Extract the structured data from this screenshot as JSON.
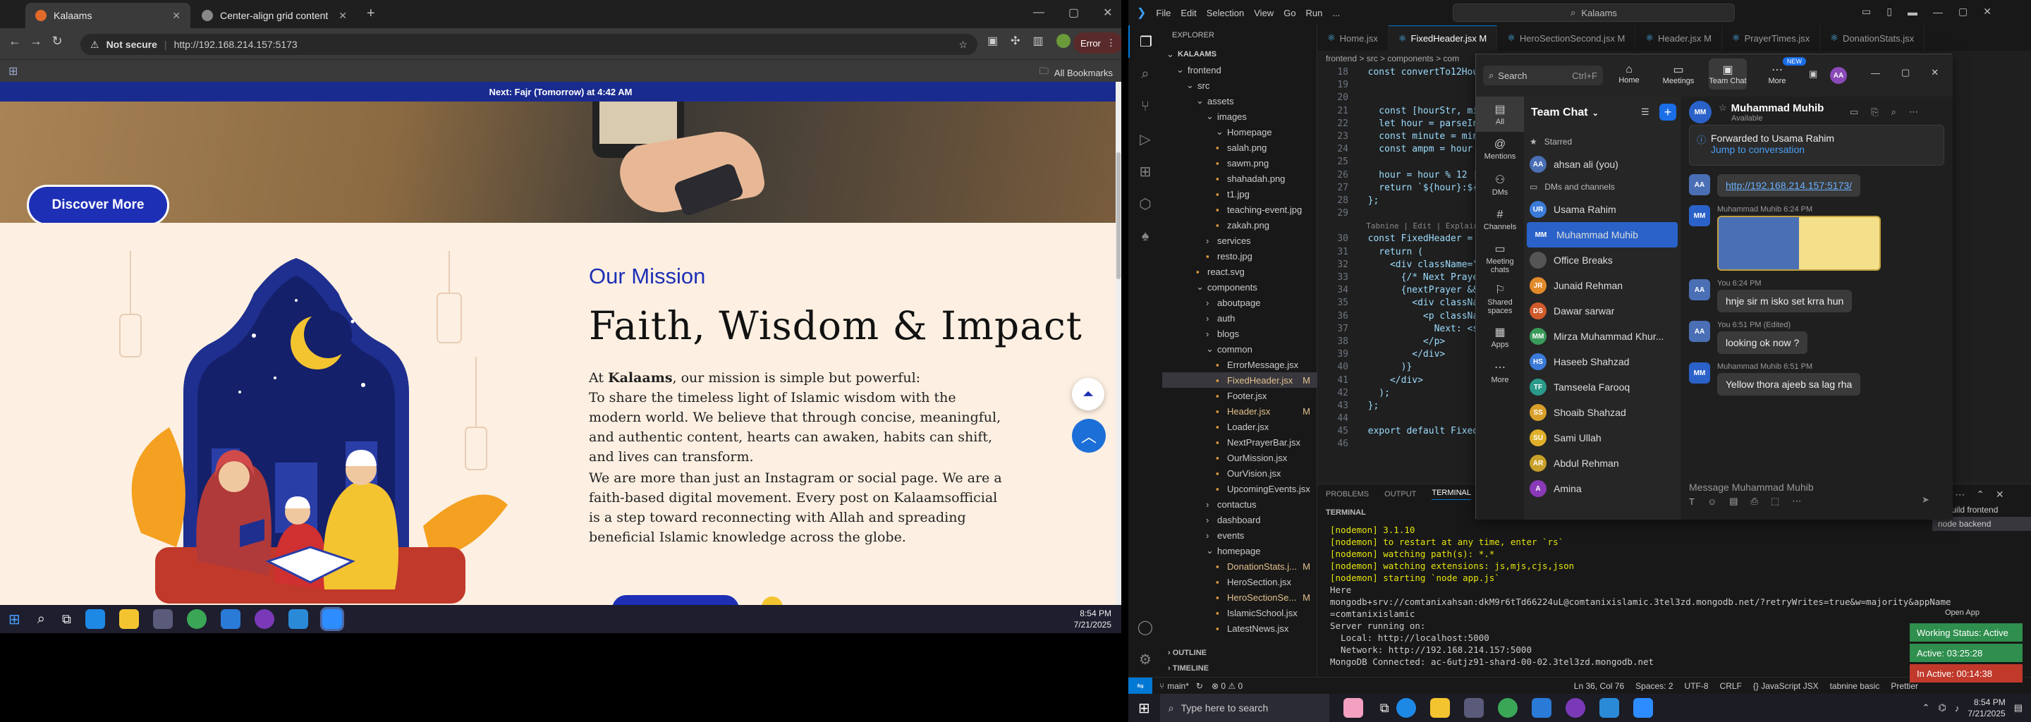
{
  "browser": {
    "tabs": [
      {
        "title": "Kalaams",
        "active": true
      },
      {
        "title": "Center-align grid content",
        "active": false
      }
    ],
    "url_warning": "Not secure",
    "url": "http://192.168.214.157:5173",
    "error_label": "Error",
    "bookmarks_label": "All Bookmarks"
  },
  "site": {
    "next_prayer": "Next: Fajr (Tomorrow) at 4:42 AM",
    "discover_button": "Discover More",
    "mission_label": "Our Mission",
    "mission_title": "Faith, Wisdom & Impact",
    "para1_prefix": "At ",
    "para1_brand": "Kalaams",
    "para1_rest": ", our mission is simple but powerful:",
    "para2": "To share the timeless light of Islamic wisdom with the modern world. We believe that through concise, meaningful, and authentic content, hearts can awaken, habits can shift, and lives can transform.",
    "para3": "We are more than just an Instagram or social page. We are a faith-based digital movement. Every post on Kalaamsofficial is a step toward reconnecting with Allah and spreading beneficial Islamic knowledge across the globe."
  },
  "left_taskbar": {
    "time": "8:54 PM",
    "date": "7/21/2025"
  },
  "vscode": {
    "menu": [
      "File",
      "Edit",
      "Selection",
      "View",
      "Go",
      "Run",
      "..."
    ],
    "search": "Kalaams",
    "explorer_title": "EXPLORER",
    "tree": [
      {
        "label": "KALAAMS",
        "depth": 0,
        "type": "root"
      },
      {
        "label": "frontend",
        "depth": 1,
        "type": "folder"
      },
      {
        "label": "src",
        "depth": 2,
        "type": "folder"
      },
      {
        "label": "assets",
        "depth": 3,
        "type": "folder"
      },
      {
        "label": "images",
        "depth": 4,
        "type": "folder"
      },
      {
        "label": "Homepage",
        "depth": 5,
        "type": "folder"
      },
      {
        "label": "salah.png",
        "depth": 5,
        "type": "file"
      },
      {
        "label": "sawm.png",
        "depth": 5,
        "type": "file"
      },
      {
        "label": "shahadah.png",
        "depth": 5,
        "type": "file"
      },
      {
        "label": "t1.jpg",
        "depth": 5,
        "type": "file"
      },
      {
        "label": "teaching-event.jpg",
        "depth": 5,
        "type": "file"
      },
      {
        "label": "zakah.png",
        "depth": 5,
        "type": "file"
      },
      {
        "label": "services",
        "depth": 4,
        "type": "folder"
      },
      {
        "label": "resto.jpg",
        "depth": 4,
        "type": "file"
      },
      {
        "label": "react.svg",
        "depth": 3,
        "type": "file"
      },
      {
        "label": "components",
        "depth": 3,
        "type": "folder"
      },
      {
        "label": "aboutpage",
        "depth": 4,
        "type": "folder"
      },
      {
        "label": "auth",
        "depth": 4,
        "type": "folder"
      },
      {
        "label": "blogs",
        "depth": 4,
        "type": "folder"
      },
      {
        "label": "common",
        "depth": 4,
        "type": "folder"
      },
      {
        "label": "ErrorMessage.jsx",
        "depth": 5,
        "type": "file"
      },
      {
        "label": "FixedHeader.jsx",
        "depth": 5,
        "type": "file",
        "badge": "M",
        "selected": true
      },
      {
        "label": "Footer.jsx",
        "depth": 5,
        "type": "file"
      },
      {
        "label": "Header.jsx",
        "depth": 5,
        "type": "file",
        "badge": "M"
      },
      {
        "label": "Loader.jsx",
        "depth": 5,
        "type": "file"
      },
      {
        "label": "NextPrayerBar.jsx",
        "depth": 5,
        "type": "file"
      },
      {
        "label": "OurMission.jsx",
        "depth": 5,
        "type": "file"
      },
      {
        "label": "OurVision.jsx",
        "depth": 5,
        "type": "file"
      },
      {
        "label": "UpcomingEvents.jsx",
        "depth": 5,
        "type": "file"
      },
      {
        "label": "contactus",
        "depth": 4,
        "type": "folder"
      },
      {
        "label": "dashboard",
        "depth": 4,
        "type": "folder"
      },
      {
        "label": "events",
        "depth": 4,
        "type": "folder"
      },
      {
        "label": "homepage",
        "depth": 4,
        "type": "folder"
      },
      {
        "label": "DonationStats.j...",
        "depth": 5,
        "type": "file",
        "badge": "M"
      },
      {
        "label": "HeroSection.jsx",
        "depth": 5,
        "type": "file"
      },
      {
        "label": "HeroSectionSe...",
        "depth": 5,
        "type": "file",
        "badge": "M"
      },
      {
        "label": "IslamicSchool.jsx",
        "depth": 5,
        "type": "file"
      },
      {
        "label": "LatestNews.jsx",
        "depth": 5,
        "type": "file"
      }
    ],
    "outline": "OUTLINE",
    "timeline": "TIMELINE",
    "editor_tabs": [
      {
        "label": "Home.jsx",
        "active": false
      },
      {
        "label": "FixedHeader.jsx M",
        "active": true
      },
      {
        "label": "HeroSectionSecond.jsx M",
        "active": false
      },
      {
        "label": "Header.jsx M",
        "active": false
      },
      {
        "label": "PrayerTimes.jsx",
        "active": false
      },
      {
        "label": "DonationStats.jsx",
        "active": false
      }
    ],
    "breadcrumb": "frontend > src > components > com",
    "code_lines": [
      {
        "n": "18",
        "t": "  const convertTo12Hou"
      },
      {
        "n": "19",
        "t": ""
      },
      {
        "n": "20",
        "t": ""
      },
      {
        "n": "21",
        "t": "    const [hourStr, min"
      },
      {
        "n": "22",
        "t": "    let hour = parseInt"
      },
      {
        "n": "23",
        "t": "    const minute = minu"
      },
      {
        "n": "24",
        "t": "    const ampm = hour >"
      },
      {
        "n": "25",
        "t": ""
      },
      {
        "n": "26",
        "t": "    hour = hour % 12 ||"
      },
      {
        "n": "27",
        "t": "    return `${hour}:${m"
      },
      {
        "n": "28",
        "t": "  };"
      },
      {
        "n": "29",
        "t": ""
      },
      {
        "n": "",
        "t": "  Tabnine | Edit | Explain"
      },
      {
        "n": "30",
        "t": "  const FixedHeader = ("
      },
      {
        "n": "31",
        "t": "    return ("
      },
      {
        "n": "32",
        "t": "      <div className=\""
      },
      {
        "n": "33",
        "t": "        {/* Next Prayer"
      },
      {
        "n": "34",
        "t": "        {nextPrayer &&"
      },
      {
        "n": "35",
        "t": "          <div classNam"
      },
      {
        "n": "36",
        "t": "            <p classNam"
      },
      {
        "n": "37",
        "t": "              Next: <st"
      },
      {
        "n": "38",
        "t": "            </p>"
      },
      {
        "n": "39",
        "t": "          </div>"
      },
      {
        "n": "40",
        "t": "        )}"
      },
      {
        "n": "41",
        "t": "      </div>"
      },
      {
        "n": "42",
        "t": "    );"
      },
      {
        "n": "43",
        "t": "  };"
      },
      {
        "n": "44",
        "t": ""
      },
      {
        "n": "45",
        "t": "  export default FixedH"
      },
      {
        "n": "46",
        "t": ""
      }
    ],
    "panel_tabs": [
      "PROBLEMS",
      "OUTPUT",
      "TERMINAL"
    ],
    "terminal_label": "TERMINAL",
    "terminal_lines": [
      "[nodemon] 3.1.10",
      "[nodemon] to restart at any time, enter `rs`",
      "[nodemon] watching path(s): *.*",
      "[nodemon] watching extensions: js,mjs,cjs,json",
      "[nodemon] starting `node app.js`",
      "Here",
      "mongodb+srv://comtanixahsan:dkM9r6tTd66224uL@comtanixislamic.3tel3zd.mongodb.net/?retryWrites=true&w=majority&appName",
      "=comtanixislamic",
      "Server running on:",
      "  Local: http://localhost:5000",
      "  Network: http://192.168.214.157:5000",
      "MongoDB Connected: ac-6utjz91-shard-00-02.3tel3zd.mongodb.net"
    ],
    "terminal_instances": [
      {
        "label": "esbuild frontend"
      },
      {
        "label": "node backend"
      }
    ],
    "open_app": "Open App",
    "status": {
      "branch": "main*",
      "errors": "⊗ 0 ⚠ 0",
      "cursor": "Ln 36, Col 76",
      "spaces": "Spaces: 2",
      "encoding": "UTF-8",
      "eol": "CRLF",
      "language": "{} JavaScript JSX",
      "tabnine": "tabnine basic",
      "prettier": "Prettier"
    }
  },
  "zoom": {
    "nav": [
      "Home",
      "Meetings",
      "Team Chat",
      "More"
    ],
    "search_placeholder": "Search",
    "shortcut": "Ctrl+F",
    "new_badge": "NEW",
    "user_initials": "AA",
    "rail": [
      "All",
      "Mentions",
      "DMs",
      "Channels",
      "Meeting chats",
      "Shared spaces",
      "Apps",
      "More"
    ],
    "list_title": "Team Chat",
    "starred_label": "Starred",
    "dm_label": "DMs and channels",
    "starred": [
      {
        "name": "ahsan ali (you)",
        "initials": "AA",
        "color": "#4a6fb5"
      }
    ],
    "contacts": [
      {
        "name": "Usama Rahim",
        "initials": "UR",
        "color": "#3b7bd8"
      },
      {
        "name": "Muhammad Muhib",
        "initials": "MM",
        "color": "#2a62c9",
        "selected": true
      },
      {
        "name": "Office Breaks",
        "initials": "",
        "color": "#555"
      },
      {
        "name": "Junaid Rehman",
        "initials": "JR",
        "color": "#e08a2a"
      },
      {
        "name": "Dawar sarwar",
        "initials": "DS",
        "color": "#d25a2a"
      },
      {
        "name": "Mirza Muhammad Khur...",
        "initials": "MM",
        "color": "#3a9a5a"
      },
      {
        "name": "Haseeb Shahzad",
        "initials": "HS",
        "color": "#3a7ad8"
      },
      {
        "name": "Tamseela Farooq",
        "initials": "TF",
        "color": "#2a9a8a"
      },
      {
        "name": "Shoaib Shahzad",
        "initials": "SS",
        "color": "#d8a02a"
      },
      {
        "name": "Sami Ullah",
        "initials": "SU",
        "color": "#e0b02a"
      },
      {
        "name": "Abdul Rehman",
        "initials": "AR",
        "color": "#c8a02a"
      },
      {
        "name": "Amina",
        "initials": "A",
        "color": "#8a3ab8"
      }
    ],
    "chat_name": "Muhammad Muhib",
    "chat_status": "Available",
    "chat_initials": "MM",
    "forward_text": "Forwarded to Usama Rahim",
    "forward_link": "Jump to conversation",
    "messages": [
      {
        "initials": "AA",
        "meta": "",
        "text": "http://192.168.214.157:5173/",
        "link": true
      },
      {
        "initials": "MM",
        "meta": "Muhammad Muhib 6:24 PM",
        "text": "",
        "image": true
      },
      {
        "initials": "AA",
        "meta": "You 6:24 PM",
        "text": "hnje sir m isko set krra hun"
      },
      {
        "initials": "AA",
        "meta": "You 6:51 PM (Edited)",
        "text": "looking ok now ?"
      },
      {
        "initials": "MM",
        "meta": "Muhammad Muhib 6:51 PM",
        "text": "Yellow thora ajeeb sa lag rha"
      }
    ],
    "compose_placeholder": "Message Muhammad Muhib"
  },
  "work_status": [
    {
      "label": "Working Status: Active",
      "color": "#2f8f4e"
    },
    {
      "label": "Active: 03:25:28",
      "color": "#2f8f4e"
    },
    {
      "label": "In Active: 00:14:38",
      "color": "#c0392b"
    }
  ],
  "right_taskbar": {
    "search_placeholder": "Type here to search",
    "time": "8:54 PM",
    "date": "7/21/2025"
  }
}
